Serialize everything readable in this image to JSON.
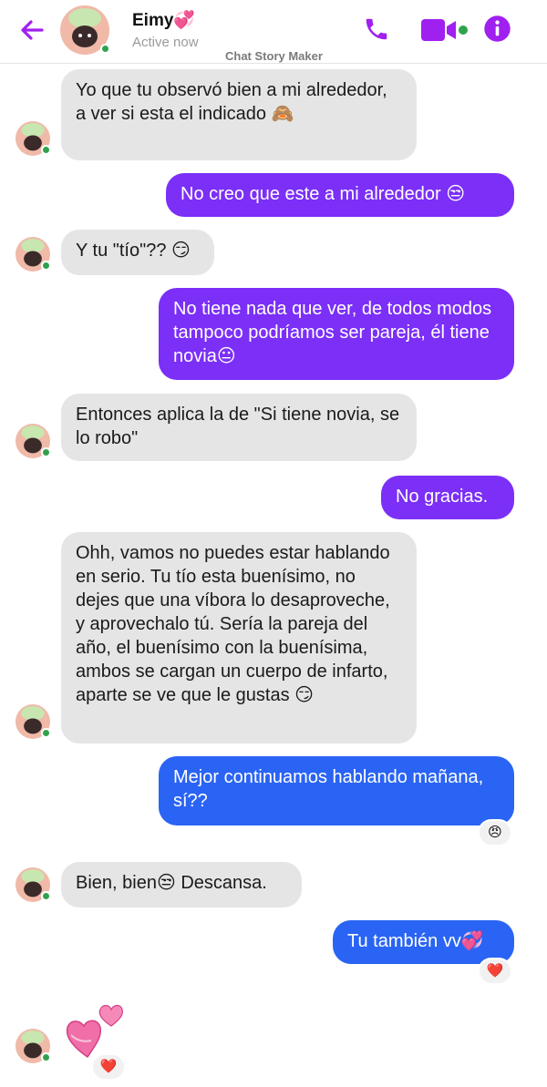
{
  "header": {
    "contact_name": "Eimy💞",
    "status": "Active now",
    "watermark": "Chat Story Maker",
    "accent_color": "#a020f0",
    "online_color": "#31a24c",
    "icons": [
      "back-arrow-icon",
      "phone-icon",
      "video-icon",
      "info-icon"
    ]
  },
  "messages": [
    {
      "id": "m1",
      "from": "contact",
      "text": "Yo que tu observó bien a mi alrededor, a ver si esta el indicado 🙈"
    },
    {
      "id": "m2",
      "from": "me",
      "text": "No creo que este a mi alrededor 😒"
    },
    {
      "id": "m3",
      "from": "contact",
      "text": "Y tu \"tío\"?? 😏"
    },
    {
      "id": "m4",
      "from": "me",
      "text": "No tiene nada que ver, de todos modos tampoco podríamos ser pareja, él tiene novia😐"
    },
    {
      "id": "m5",
      "from": "contact",
      "text": "Entonces aplica la de \"Si tiene novia, se lo robo\""
    },
    {
      "id": "m6",
      "from": "me",
      "text": "No gracias."
    },
    {
      "id": "m7",
      "from": "contact",
      "text": "Ohh, vamos no puedes estar hablando en serio. Tu tío esta buenísimo, no dejes que una víbora lo desaproveche, y aprovechalo tú. Sería la pareja del año, el buenísimo con la buenísima, ambos se cargan un cuerpo de infarto, aparte se ve que le gustas 😏"
    },
    {
      "id": "m8",
      "from": "me",
      "text": "Mejor continuamos hablando mañana, sí??",
      "reaction": "😠"
    },
    {
      "id": "m9",
      "from": "contact",
      "text": "Bien, bien😒 Descansa."
    },
    {
      "id": "m10",
      "from": "me",
      "text": "Tu también vv💞",
      "reaction": "❤️"
    },
    {
      "id": "m11",
      "from": "contact",
      "sticker": "two-hearts-sticker",
      "reaction": "❤️"
    }
  ],
  "colors": {
    "incoming_bubble": "#e5e5e5",
    "outgoing_purple": "#7b2ff7",
    "outgoing_blue": "#2a64f4"
  }
}
